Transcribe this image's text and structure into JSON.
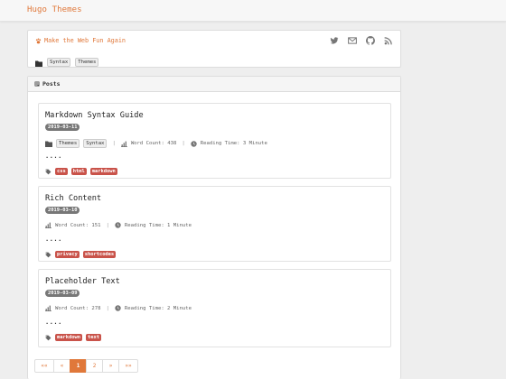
{
  "site": {
    "title": "Hugo Themes"
  },
  "profile": {
    "tagline": "Make the Web Fun Again",
    "categories": [
      "Syntax",
      "Themes"
    ],
    "social_icons": [
      "twitter-icon",
      "email-icon",
      "github-icon",
      "rss-icon"
    ]
  },
  "posts_panel": {
    "heading": "Posts"
  },
  "posts": [
    {
      "title": "Markdown Syntax Guide",
      "date": "2019-03-11",
      "categories": [
        "Themes",
        "Syntax"
      ],
      "word_count": "Word Count: 438",
      "reading_time": "Reading Time: 3 Minute",
      "summary": "....",
      "tags": [
        "css",
        "html",
        "markdown"
      ]
    },
    {
      "title": "Rich Content",
      "date": "2019-03-10",
      "categories": [],
      "word_count": "Word Count: 151",
      "reading_time": "Reading Time: 1 Minute",
      "summary": "....",
      "tags": [
        "privacy",
        "shortcodes"
      ]
    },
    {
      "title": "Placeholder Text",
      "date": "2019-03-09",
      "categories": [],
      "word_count": "Word Count: 278",
      "reading_time": "Reading Time: 2 Minute",
      "summary": "....",
      "tags": [
        "markdown",
        "text"
      ]
    }
  ],
  "pagination": {
    "first": "««",
    "prev": "«",
    "pages": [
      "1",
      "2"
    ],
    "current": "1",
    "next": "»",
    "last": "»»"
  },
  "colors": {
    "accent": "#e0783a",
    "tag": "#c9534a",
    "date_badge": "#777777"
  }
}
